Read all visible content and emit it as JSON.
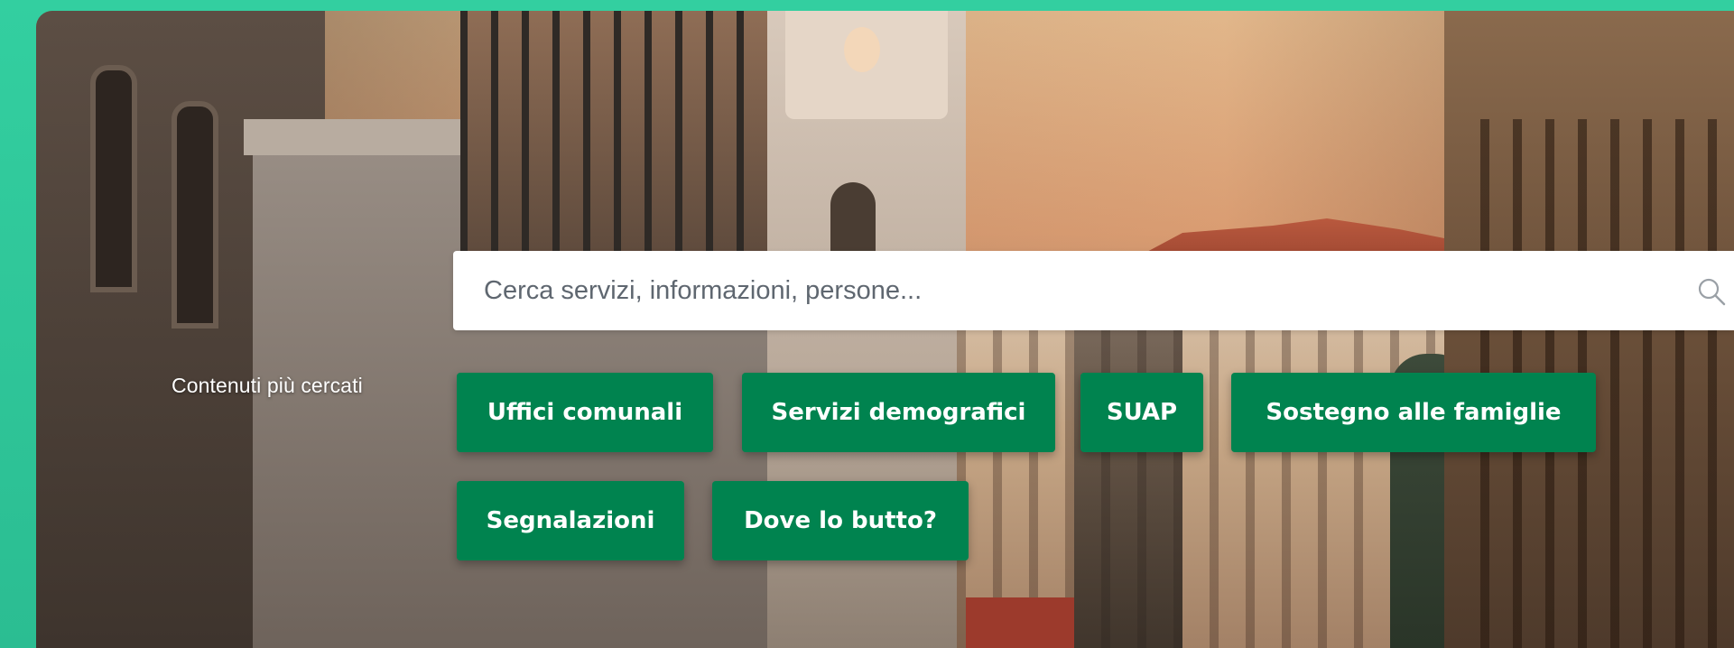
{
  "search": {
    "placeholder": "Cerca servizi, informazioni, persone..."
  },
  "most_searched": {
    "label": "Contenuti più cercati",
    "links": [
      "Uffici comunali",
      "Servizi demografici",
      "SUAP",
      "Sostegno alle famiglie",
      "Segnalazioni",
      "Dove lo butto?"
    ]
  },
  "colors": {
    "accent_green": "#00834f",
    "frame_teal": "#2ec99a"
  },
  "icons": {
    "search": "search-icon"
  }
}
